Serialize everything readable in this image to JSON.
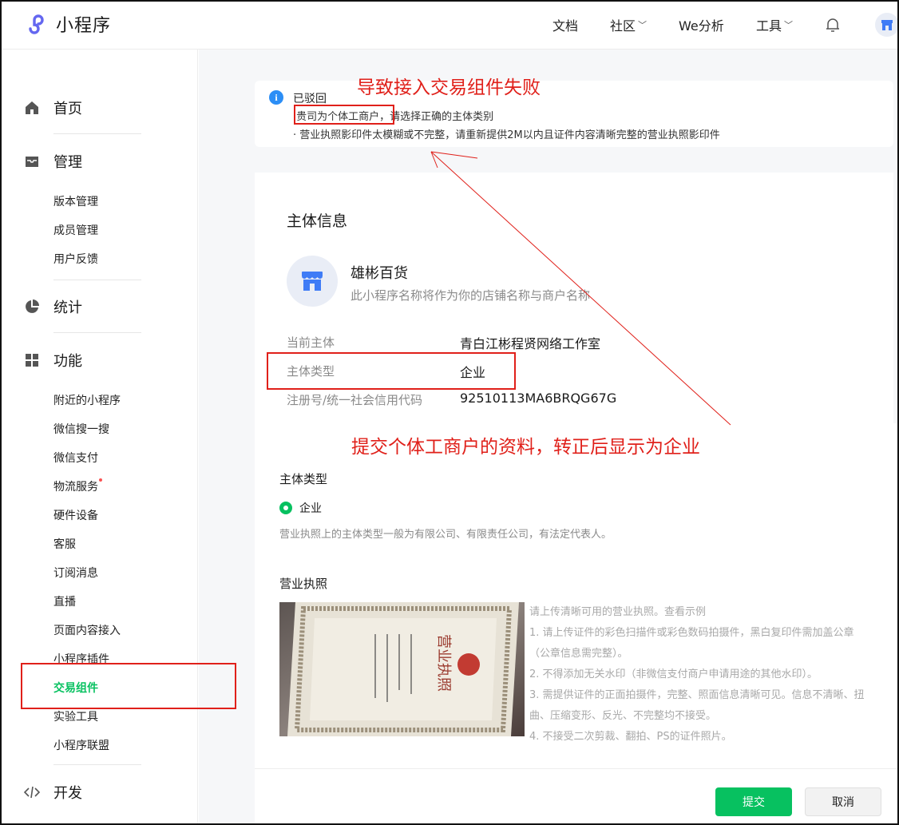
{
  "header": {
    "logo_text": "小程序",
    "nav": [
      {
        "label": "文档",
        "has_dropdown": false
      },
      {
        "label": "社区",
        "has_dropdown": true
      },
      {
        "label": "We分析",
        "has_dropdown": false
      },
      {
        "label": "工具",
        "has_dropdown": true
      }
    ]
  },
  "sidebar": {
    "home": "首页",
    "manage": {
      "label": "管理",
      "items": [
        "版本管理",
        "成员管理",
        "用户反馈"
      ]
    },
    "stats": "统计",
    "features": {
      "label": "功能",
      "items": [
        "附近的小程序",
        "微信搜一搜",
        "微信支付",
        "物流服务",
        "硬件设备",
        "客服",
        "订阅消息",
        "直播",
        "页面内容接入",
        "小程序插件",
        "交易组件",
        "实验工具",
        "小程序联盟"
      ]
    },
    "dev": "开发"
  },
  "notice": {
    "icon": "i",
    "title": "已驳回",
    "line1_prefix": "·",
    "line1_highlight": "贵司为个体工商户",
    "line1_rest": "，请选择正确的主体类别",
    "line2": "· 营业执照影印件太模糊或不完整，请重新提供2M以内且证件内容清晰完整的营业执照影印件"
  },
  "entity_card": {
    "title": "主体信息",
    "store_name": "雄彬百货",
    "store_desc": "此小程序名称将作为你的店铺名称与商户名称",
    "rows": [
      {
        "label": "当前主体",
        "value": "青白江彬程贤网络工作室"
      },
      {
        "label": "主体类型",
        "value": "企业"
      },
      {
        "label": "注册号/统一社会信用代码",
        "value": "92510113MA6BRQG67G"
      }
    ]
  },
  "form": {
    "type_label": "主体类型",
    "radio_label": "企业",
    "hint": "营业执照上的主体类型一般为有限公司、有限责任公司，有法定代表人。",
    "license_label": "营业执照",
    "license_photo_text": "营业执照",
    "upload_hints": [
      "请上传清晰可用的营业执照。查看示例",
      "1. 请上传证件的彩色扫描件或彩色数码拍摄件，黑白复印件需加盖公章（公章信息需完整）。",
      "2. 不得添加无关水印（非微信支付商户申请用途的其他水印）。",
      "3. 需提供证件的正面拍摄件，完整、照面信息清晰可见。信息不清晰、扭曲、压缩变形、反光、不完整均不接受。",
      "4. 不接受二次剪裁、翻拍、PS的证件照片。"
    ]
  },
  "footer": {
    "submit": "提交",
    "cancel": "取消"
  },
  "annotations": {
    "top": "导致接入交易组件失败",
    "middle": "提交个体工商户的资料，转正后显示为企业"
  },
  "colors": {
    "accent_green": "#07c160",
    "annotation_red": "#e0201a",
    "info_blue": "#2c8ef6"
  }
}
